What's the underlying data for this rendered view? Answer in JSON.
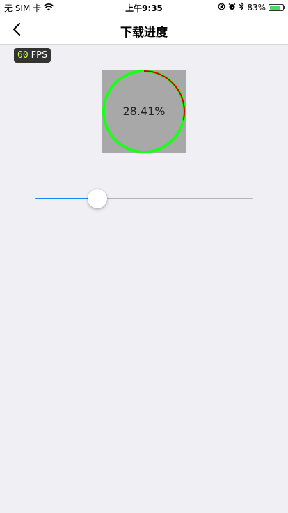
{
  "status_bar": {
    "carrier": "无 SIM 卡",
    "time": "上午9:35",
    "battery_text": "83%",
    "battery_level": 0.83,
    "wifi_icon": "wifi-icon",
    "orientation_lock_icon": "orientation-lock-icon",
    "alarm_icon": "alarm-icon",
    "bluetooth_icon": "bluetooth-icon",
    "battery_color": "#4cd964"
  },
  "nav": {
    "title": "下载进度",
    "back_icon": "chevron-left-icon"
  },
  "fps": {
    "value": "60",
    "label": "FPS"
  },
  "progress": {
    "text": "28.41%",
    "fraction": 0.2841,
    "ring_color": "#19ff19",
    "progress_color": "#d40000",
    "background_color": "#a8a8a8"
  },
  "slider": {
    "value": 0.2841,
    "fill_color": "#1a84ff",
    "track_color": "#b5b5b5"
  }
}
